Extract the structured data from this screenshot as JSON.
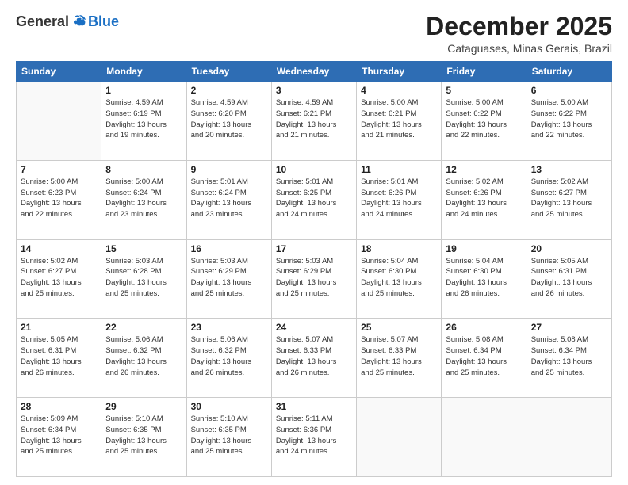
{
  "header": {
    "logo_general": "General",
    "logo_blue": "Blue",
    "month": "December 2025",
    "location": "Cataguases, Minas Gerais, Brazil"
  },
  "weekdays": [
    "Sunday",
    "Monday",
    "Tuesday",
    "Wednesday",
    "Thursday",
    "Friday",
    "Saturday"
  ],
  "weeks": [
    [
      {
        "day": "",
        "content": ""
      },
      {
        "day": "1",
        "content": "Sunrise: 4:59 AM\nSunset: 6:19 PM\nDaylight: 13 hours\nand 19 minutes."
      },
      {
        "day": "2",
        "content": "Sunrise: 4:59 AM\nSunset: 6:20 PM\nDaylight: 13 hours\nand 20 minutes."
      },
      {
        "day": "3",
        "content": "Sunrise: 4:59 AM\nSunset: 6:21 PM\nDaylight: 13 hours\nand 21 minutes."
      },
      {
        "day": "4",
        "content": "Sunrise: 5:00 AM\nSunset: 6:21 PM\nDaylight: 13 hours\nand 21 minutes."
      },
      {
        "day": "5",
        "content": "Sunrise: 5:00 AM\nSunset: 6:22 PM\nDaylight: 13 hours\nand 22 minutes."
      },
      {
        "day": "6",
        "content": "Sunrise: 5:00 AM\nSunset: 6:22 PM\nDaylight: 13 hours\nand 22 minutes."
      }
    ],
    [
      {
        "day": "7",
        "content": "Sunrise: 5:00 AM\nSunset: 6:23 PM\nDaylight: 13 hours\nand 22 minutes."
      },
      {
        "day": "8",
        "content": "Sunrise: 5:00 AM\nSunset: 6:24 PM\nDaylight: 13 hours\nand 23 minutes."
      },
      {
        "day": "9",
        "content": "Sunrise: 5:01 AM\nSunset: 6:24 PM\nDaylight: 13 hours\nand 23 minutes."
      },
      {
        "day": "10",
        "content": "Sunrise: 5:01 AM\nSunset: 6:25 PM\nDaylight: 13 hours\nand 24 minutes."
      },
      {
        "day": "11",
        "content": "Sunrise: 5:01 AM\nSunset: 6:26 PM\nDaylight: 13 hours\nand 24 minutes."
      },
      {
        "day": "12",
        "content": "Sunrise: 5:02 AM\nSunset: 6:26 PM\nDaylight: 13 hours\nand 24 minutes."
      },
      {
        "day": "13",
        "content": "Sunrise: 5:02 AM\nSunset: 6:27 PM\nDaylight: 13 hours\nand 25 minutes."
      }
    ],
    [
      {
        "day": "14",
        "content": "Sunrise: 5:02 AM\nSunset: 6:27 PM\nDaylight: 13 hours\nand 25 minutes."
      },
      {
        "day": "15",
        "content": "Sunrise: 5:03 AM\nSunset: 6:28 PM\nDaylight: 13 hours\nand 25 minutes."
      },
      {
        "day": "16",
        "content": "Sunrise: 5:03 AM\nSunset: 6:29 PM\nDaylight: 13 hours\nand 25 minutes."
      },
      {
        "day": "17",
        "content": "Sunrise: 5:03 AM\nSunset: 6:29 PM\nDaylight: 13 hours\nand 25 minutes."
      },
      {
        "day": "18",
        "content": "Sunrise: 5:04 AM\nSunset: 6:30 PM\nDaylight: 13 hours\nand 25 minutes."
      },
      {
        "day": "19",
        "content": "Sunrise: 5:04 AM\nSunset: 6:30 PM\nDaylight: 13 hours\nand 26 minutes."
      },
      {
        "day": "20",
        "content": "Sunrise: 5:05 AM\nSunset: 6:31 PM\nDaylight: 13 hours\nand 26 minutes."
      }
    ],
    [
      {
        "day": "21",
        "content": "Sunrise: 5:05 AM\nSunset: 6:31 PM\nDaylight: 13 hours\nand 26 minutes."
      },
      {
        "day": "22",
        "content": "Sunrise: 5:06 AM\nSunset: 6:32 PM\nDaylight: 13 hours\nand 26 minutes."
      },
      {
        "day": "23",
        "content": "Sunrise: 5:06 AM\nSunset: 6:32 PM\nDaylight: 13 hours\nand 26 minutes."
      },
      {
        "day": "24",
        "content": "Sunrise: 5:07 AM\nSunset: 6:33 PM\nDaylight: 13 hours\nand 26 minutes."
      },
      {
        "day": "25",
        "content": "Sunrise: 5:07 AM\nSunset: 6:33 PM\nDaylight: 13 hours\nand 25 minutes."
      },
      {
        "day": "26",
        "content": "Sunrise: 5:08 AM\nSunset: 6:34 PM\nDaylight: 13 hours\nand 25 minutes."
      },
      {
        "day": "27",
        "content": "Sunrise: 5:08 AM\nSunset: 6:34 PM\nDaylight: 13 hours\nand 25 minutes."
      }
    ],
    [
      {
        "day": "28",
        "content": "Sunrise: 5:09 AM\nSunset: 6:34 PM\nDaylight: 13 hours\nand 25 minutes."
      },
      {
        "day": "29",
        "content": "Sunrise: 5:10 AM\nSunset: 6:35 PM\nDaylight: 13 hours\nand 25 minutes."
      },
      {
        "day": "30",
        "content": "Sunrise: 5:10 AM\nSunset: 6:35 PM\nDaylight: 13 hours\nand 25 minutes."
      },
      {
        "day": "31",
        "content": "Sunrise: 5:11 AM\nSunset: 6:36 PM\nDaylight: 13 hours\nand 24 minutes."
      },
      {
        "day": "",
        "content": ""
      },
      {
        "day": "",
        "content": ""
      },
      {
        "day": "",
        "content": ""
      }
    ]
  ]
}
